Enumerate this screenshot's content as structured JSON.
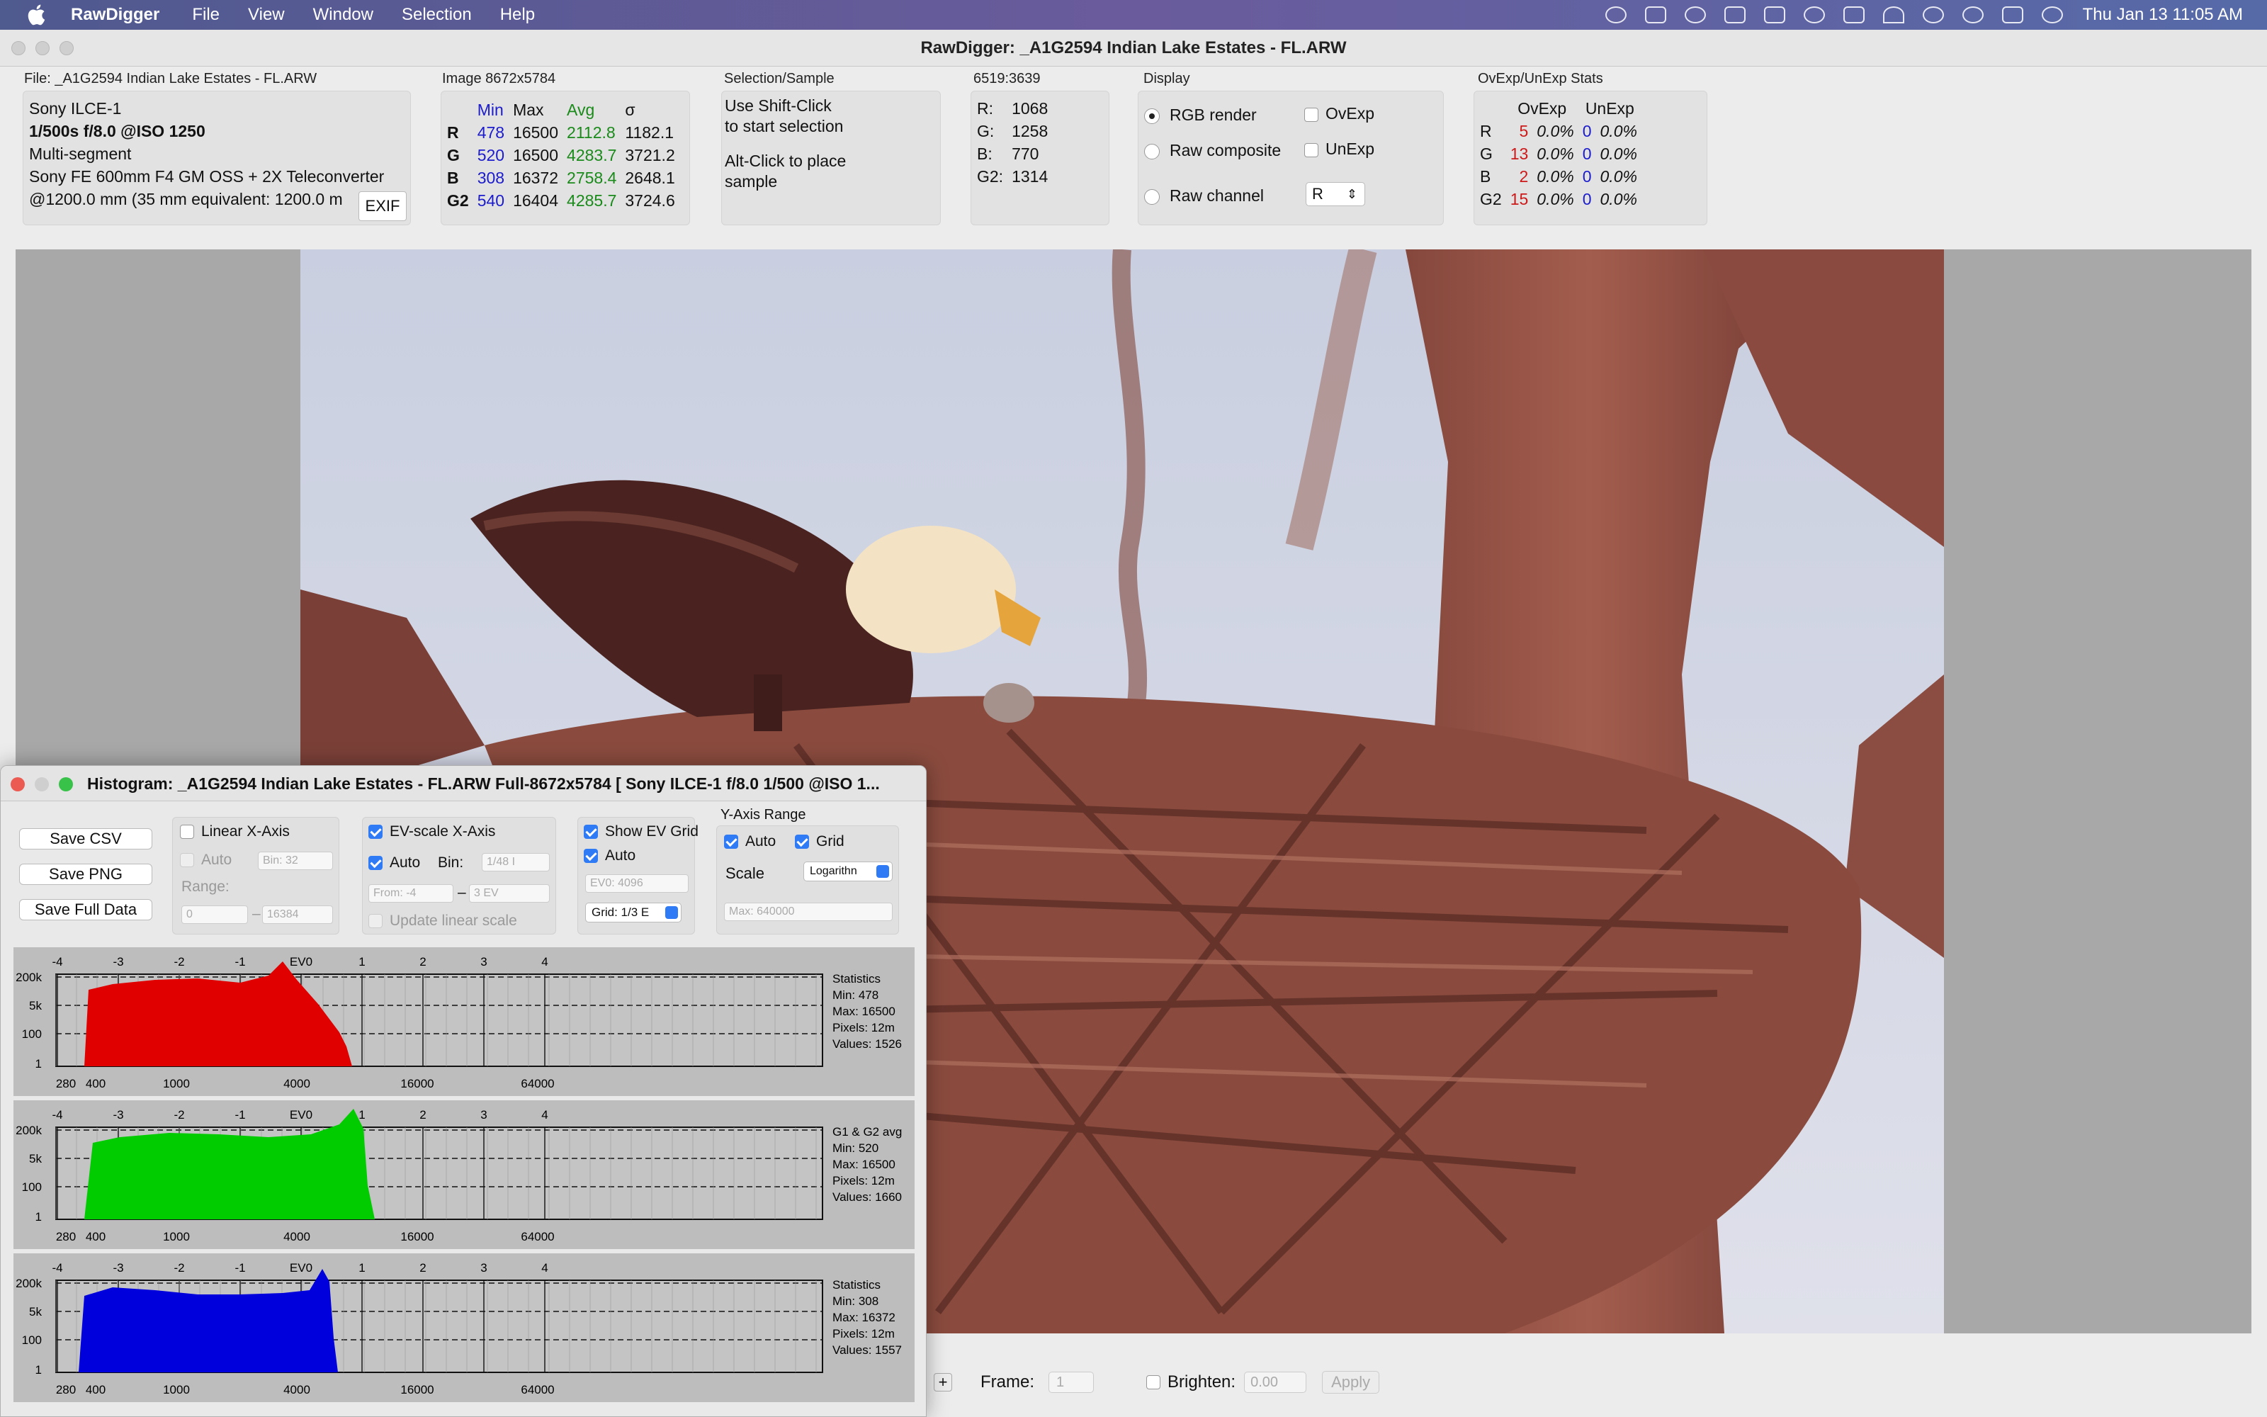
{
  "menubar": {
    "app": "RawDigger",
    "items": [
      "File",
      "View",
      "Window",
      "Selection",
      "Help"
    ],
    "clock": "Thu Jan 13  11:05 AM"
  },
  "window": {
    "title": "RawDigger: _A1G2594 Indian Lake Estates - FL.ARW"
  },
  "file": {
    "header": "File: _A1G2594 Indian Lake Estates - FL.ARW",
    "camera": "Sony ILCE-1",
    "exposure": "1/500s f/8.0 @ISO 1250",
    "mode": "Multi-segment",
    "lens": "Sony FE 600mm F4 GM OSS + 2X Teleconverter",
    "focal": "@1200.0 mm (35 mm equivalent: 1200.0 m",
    "exif_button": "EXIF"
  },
  "image_stats": {
    "header": "Image 8672x5784",
    "columns": [
      "Min",
      "Max",
      "Avg",
      "σ"
    ],
    "rows": [
      {
        "ch": "R",
        "min": "478",
        "max": "16500",
        "avg": "2112.8",
        "sd": "1182.1"
      },
      {
        "ch": "G",
        "min": "520",
        "max": "16500",
        "avg": "4283.7",
        "sd": "3721.2"
      },
      {
        "ch": "B",
        "min": "308",
        "max": "16372",
        "avg": "2758.4",
        "sd": "2648.1"
      },
      {
        "ch": "G2",
        "min": "540",
        "max": "16404",
        "avg": "4285.7",
        "sd": "3724.6"
      }
    ]
  },
  "selection": {
    "header": "Selection/Sample",
    "line1": "Use Shift-Click",
    "line2": "to start selection",
    "line3": "Alt-Click to place",
    "line4": "sample"
  },
  "sample": {
    "header": "6519:3639",
    "rows": [
      {
        "ch": "R:",
        "val": "1068"
      },
      {
        "ch": "G:",
        "val": "1258"
      },
      {
        "ch": "B:",
        "val": "770"
      },
      {
        "ch": "G2:",
        "val": "1314"
      }
    ]
  },
  "display": {
    "header": "Display",
    "rgb_render": "RGB render",
    "raw_composite": "Raw composite",
    "raw_channel": "Raw channel",
    "ovexp": "OvExp",
    "unexp": "UnExp",
    "channel_value": "R"
  },
  "ovexp_stats": {
    "header": "OvExp/UnExp Stats",
    "columns": [
      "OvExp",
      "UnExp"
    ],
    "rows": [
      {
        "ch": "R",
        "ov": "5",
        "ovp": "0.0%",
        "un": "0",
        "unp": "0.0%"
      },
      {
        "ch": "G",
        "ov": "13",
        "ovp": "0.0%",
        "un": "0",
        "unp": "0.0%"
      },
      {
        "ch": "B",
        "ov": "2",
        "ovp": "0.0%",
        "un": "0",
        "unp": "0.0%"
      },
      {
        "ch": "G2",
        "ov": "15",
        "ovp": "0.0%",
        "un": "0",
        "unp": "0.0%"
      }
    ]
  },
  "bottom": {
    "frame_label": "Frame:",
    "frame_value": "1",
    "brighten_label": "Brighten:",
    "brighten_value": "0.00",
    "apply": "Apply",
    "plus": "+"
  },
  "histogram": {
    "title": "Histogram: _A1G2594 Indian Lake Estates - FL.ARW Full-8672x5784 [ Sony ILCE-1 f/8.0 1/500 @ISO 1...",
    "buttons": [
      "Save CSV",
      "Save PNG",
      "Save Full Data"
    ],
    "linear": {
      "label": "Linear X-Axis",
      "auto": "Auto",
      "bin_field": "Bin: 32",
      "range": "Range:",
      "from": "0",
      "to": "16384"
    },
    "ev": {
      "label": "EV-scale X-Axis",
      "auto": "Auto",
      "bin": "Bin:",
      "bin_field": "1/48 I",
      "from": "From: -4",
      "to": "3 EV",
      "update": "Update linear scale"
    },
    "evgrid": {
      "label": "Show EV Grid",
      "auto": "Auto",
      "ev0": "EV0: 4096",
      "grid": "Grid: 1/3 E"
    },
    "yaxis": {
      "label": "Y-Axis Range",
      "auto": "Auto",
      "grid": "Grid",
      "scale": "Scale",
      "scale_value": "Logarithn",
      "max": "Max: 640000"
    },
    "ev_ticks": [
      "-4",
      "-3",
      "-2",
      "-1",
      "EV0",
      "1",
      "2",
      "3",
      "4"
    ],
    "x_ticks": [
      "280",
      "400",
      "1000",
      "4000",
      "16000",
      "64000"
    ],
    "y_ticks": [
      "200k",
      "5k",
      "100",
      "1"
    ],
    "channels": [
      {
        "color": "#e00000",
        "stats": [
          "Statistics",
          "Min: 478",
          "Max: 16500",
          "Pixels: 12m",
          "Values: 1526"
        ]
      },
      {
        "color": "#00cc00",
        "stats": [
          "G1 & G2 avg",
          "Min: 520",
          "Max: 16500",
          "Pixels: 12m",
          "Values: 1660"
        ]
      },
      {
        "color": "#0000dd",
        "stats": [
          "Statistics",
          "Min: 308",
          "Max: 16372",
          "Pixels: 12m",
          "Values: 1557"
        ]
      }
    ]
  }
}
